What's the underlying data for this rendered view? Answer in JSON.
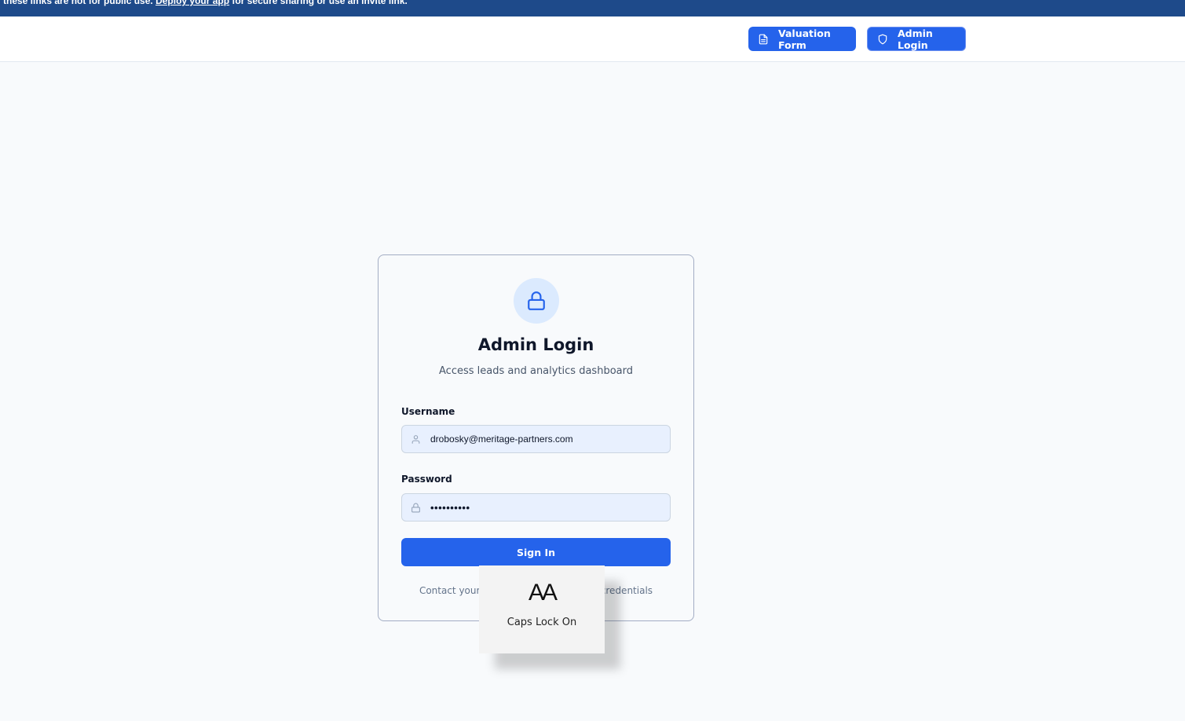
{
  "banner": {
    "text_before": "these links are not for public use.",
    "link": "Deploy your app",
    "text_after": "for secure sharing or use an invite link."
  },
  "header": {
    "valuation_button": "Valuation Form",
    "admin_button": "Admin Login"
  },
  "card": {
    "title": "Admin Login",
    "subtitle": "Access leads and analytics dashboard",
    "username_label": "Username",
    "username_value": "drobosky@meritage-partners.com",
    "password_label": "Password",
    "password_value": "••••••••••",
    "signin_label": "Sign In",
    "footnote": "Contact your administrator for access credentials"
  },
  "caps_lock": {
    "glyph": "AA",
    "text": "Caps Lock On"
  },
  "colors": {
    "primary": "#2563eb",
    "banner": "#1e4a8a",
    "lock_bg": "#dbeafe",
    "field_bg": "#e8f0fe"
  },
  "icons": [
    "document-icon",
    "shield-icon",
    "lock-icon",
    "user-icon",
    "lock-small-icon"
  ]
}
